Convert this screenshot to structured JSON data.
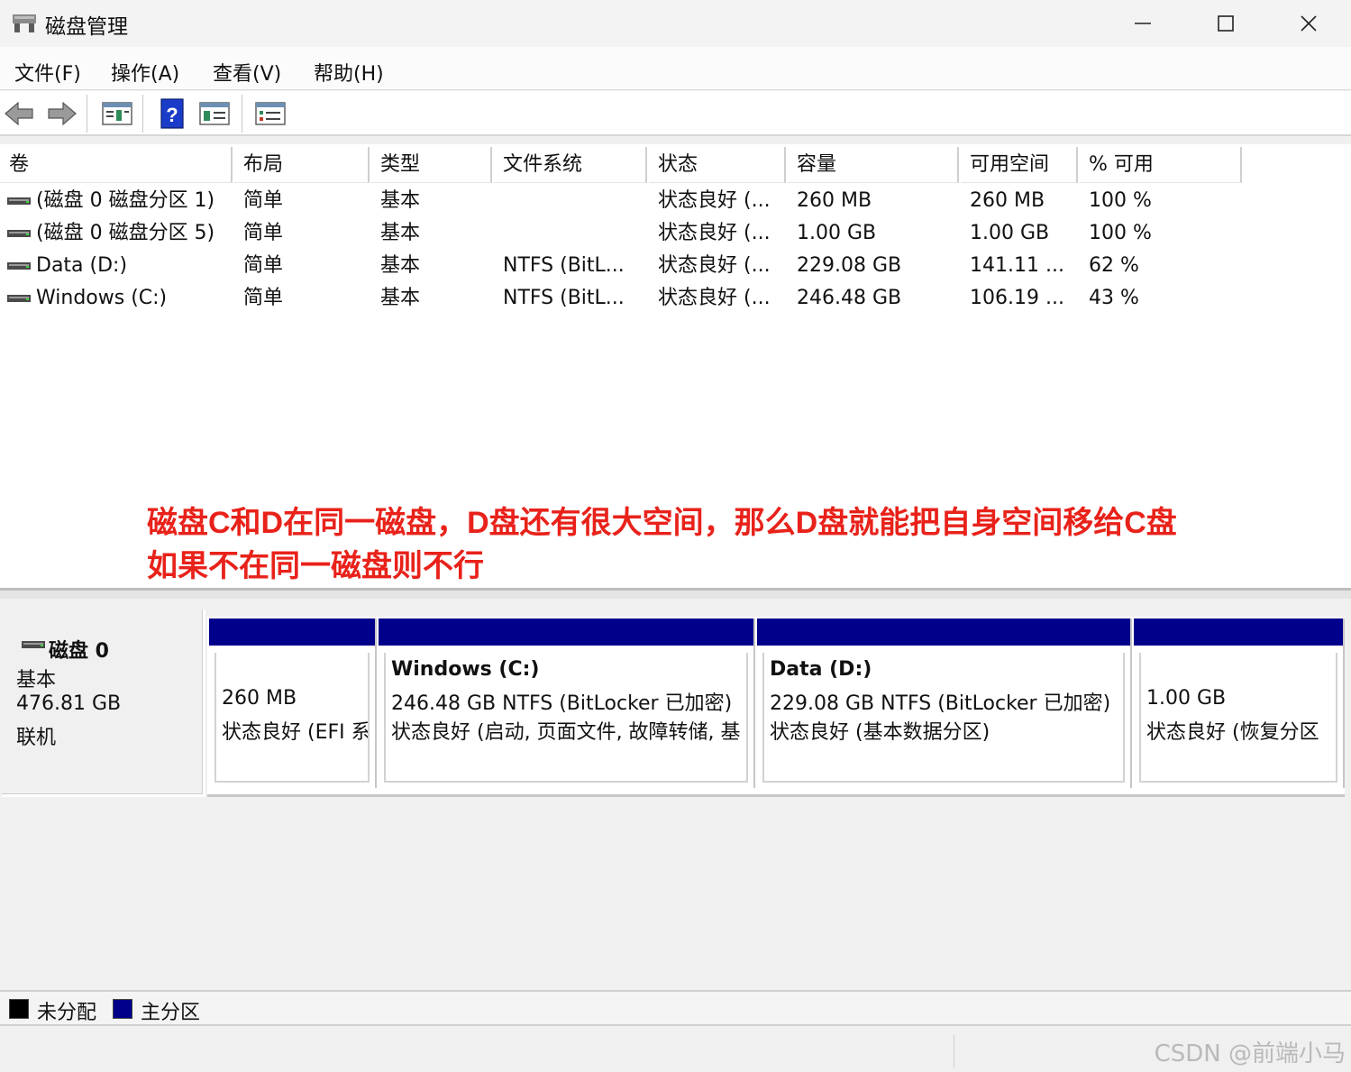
{
  "window": {
    "title": "磁盘管理"
  },
  "menu": [
    "文件(F)",
    "操作(A)",
    "查看(V)",
    "帮助(H)"
  ],
  "toolbar": {
    "buttons": [
      "back-arrow-icon",
      "forward-arrow-icon",
      "disk-list-icon",
      "help-icon",
      "disk-view-icon",
      "properties-icon"
    ]
  },
  "volume_table": {
    "headers": [
      "卷",
      "布局",
      "类型",
      "文件系统",
      "状态",
      "容量",
      "可用空间",
      "% 可用"
    ],
    "rows": [
      {
        "volume": "(磁盘 0 磁盘分区 1)",
        "layout": "简单",
        "type": "基本",
        "fs": "",
        "status": "状态良好 (...",
        "capacity": "260 MB",
        "free": "260 MB",
        "pct": "100 %"
      },
      {
        "volume": "(磁盘 0 磁盘分区 5)",
        "layout": "简单",
        "type": "基本",
        "fs": "",
        "status": "状态良好 (...",
        "capacity": "1.00 GB",
        "free": "1.00 GB",
        "pct": "100 %"
      },
      {
        "volume": "Data (D:)",
        "layout": "简单",
        "type": "基本",
        "fs": "NTFS (BitL...",
        "status": "状态良好 (...",
        "capacity": "229.08 GB",
        "free": "141.11 ...",
        "pct": "62 %"
      },
      {
        "volume": "Windows (C:)",
        "layout": "简单",
        "type": "基本",
        "fs": "NTFS (BitL...",
        "status": "状态良好 (...",
        "capacity": "246.48 GB",
        "free": "106.19 ...",
        "pct": "43 %"
      }
    ]
  },
  "annotation": {
    "line1": "磁盘C和D在同一磁盘，D盘还有很大空间，那么D盘就能把自身空间移给C盘",
    "line2": "如果不在同一磁盘则不行"
  },
  "disk": {
    "name": "磁盘 0",
    "type": "基本",
    "size": "476.81 GB",
    "state": "联机",
    "partitions": [
      {
        "title": "",
        "line1": "260 MB",
        "line2": "状态良好 (EFI 系"
      },
      {
        "title": "Windows  (C:)",
        "line1": "246.48 GB NTFS (BitLocker 已加密)",
        "line2": "状态良好 (启动, 页面文件, 故障转储, 基"
      },
      {
        "title": "Data  (D:)",
        "line1": "229.08 GB NTFS (BitLocker 已加密)",
        "line2": "状态良好 (基本数据分区)"
      },
      {
        "title": "",
        "line1": "1.00 GB",
        "line2": "状态良好 (恢复分区"
      }
    ]
  },
  "legend": [
    {
      "label": "未分配",
      "color": "#000000"
    },
    {
      "label": "主分区",
      "color": "#00008b"
    }
  ],
  "status": {
    "watermark": "CSDN @前端小马"
  },
  "colors": {
    "primary_partition": "#00008b",
    "annotation": "#e8221a"
  }
}
